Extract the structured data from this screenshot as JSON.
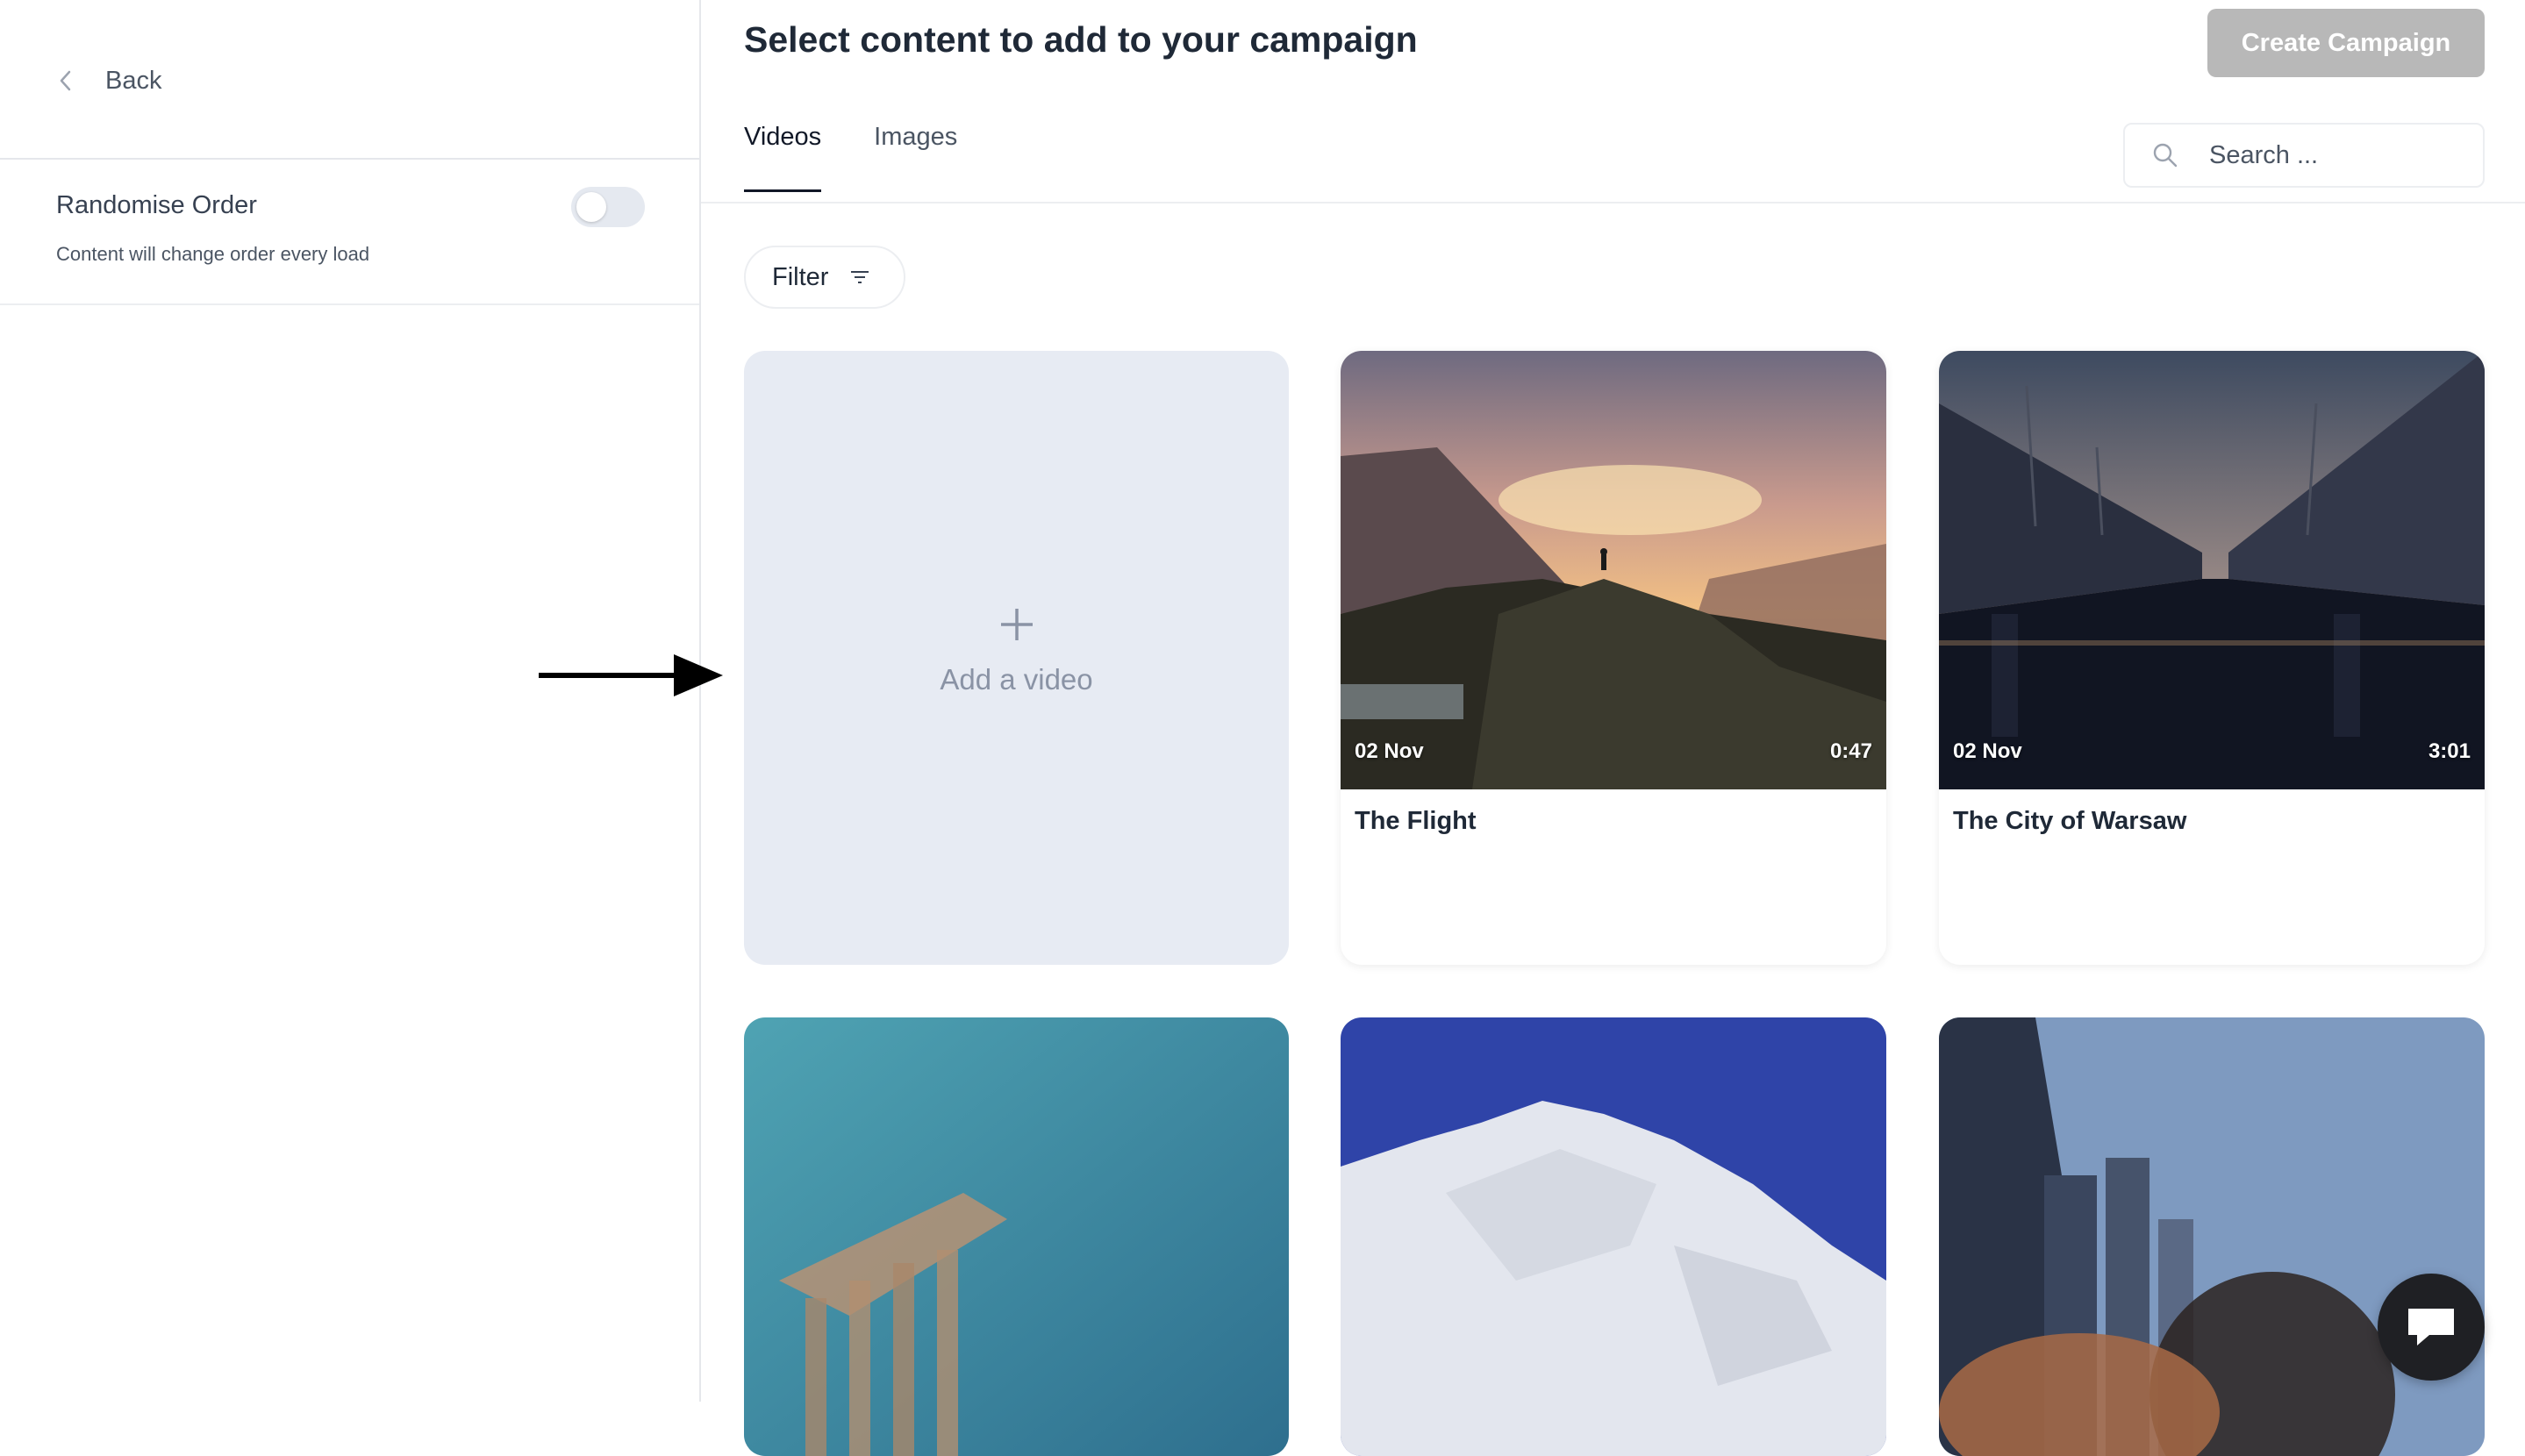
{
  "sidebar": {
    "back_label": "Back",
    "randomise": {
      "title": "Randomise Order",
      "description": "Content will change order every load",
      "enabled": false
    }
  },
  "header": {
    "title": "Select content to add to your campaign",
    "create_button": "Create Campaign"
  },
  "tabs": [
    {
      "label": "Videos",
      "active": true
    },
    {
      "label": "Images",
      "active": false
    }
  ],
  "search": {
    "placeholder": "Search ..."
  },
  "filter": {
    "label": "Filter"
  },
  "add_card": {
    "label": "Add a video"
  },
  "videos": [
    {
      "title": "The Flight",
      "date": "02 Nov",
      "duration": "0:47"
    },
    {
      "title": "The City of Warsaw",
      "date": "02 Nov",
      "duration": "3:01"
    }
  ],
  "colors": {
    "create_button_disabled": "#b8b8b8",
    "add_card_bg": "#e7ebf3",
    "toggle_off": "#e5e9f0",
    "chat_button": "#1f2024"
  }
}
